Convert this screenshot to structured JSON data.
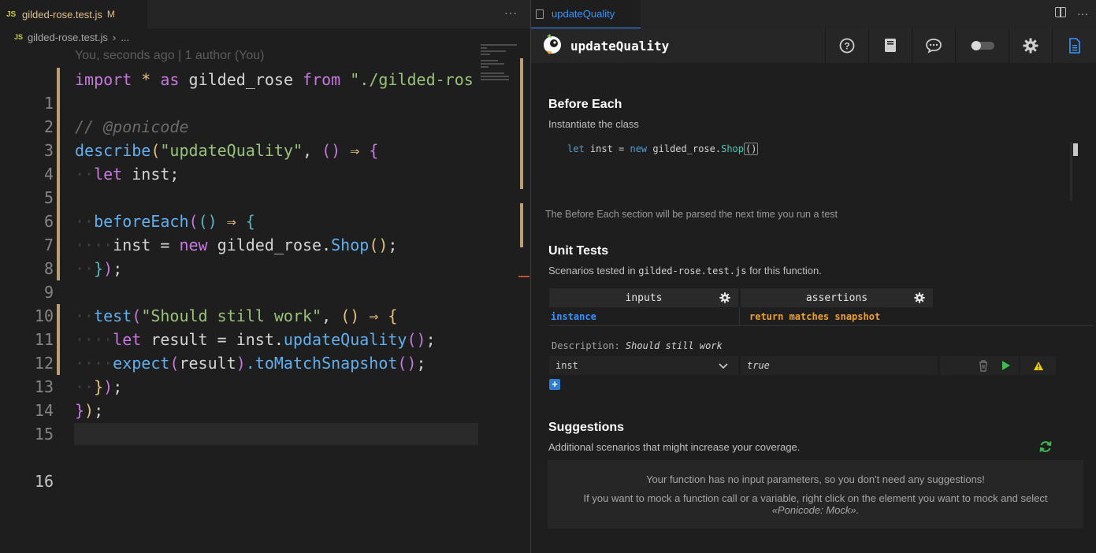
{
  "editor": {
    "tab": {
      "icon": "js-icon",
      "name": "gilded-rose.test.js",
      "status": "M",
      "more": "···"
    },
    "breadcrumb": {
      "file": "gilded-rose.test.js",
      "sep": "›",
      "more": "..."
    },
    "blame": "You, seconds ago | 1 author (You)",
    "lines": [
      {
        "n": "1"
      },
      {
        "n": "2"
      },
      {
        "n": "3"
      },
      {
        "n": "4"
      },
      {
        "n": "5"
      },
      {
        "n": "6"
      },
      {
        "n": "7"
      },
      {
        "n": "8"
      },
      {
        "n": "9"
      },
      {
        "n": "10"
      },
      {
        "n": "11"
      },
      {
        "n": "12"
      },
      {
        "n": "13"
      },
      {
        "n": "14"
      },
      {
        "n": "15"
      },
      {
        "n": "16"
      }
    ],
    "code": {
      "l1": [
        "import",
        "*",
        "as",
        "gilded_rose",
        "from",
        "\"./gilded-ros"
      ],
      "l3": "// @ponicode",
      "l4": [
        "describe",
        "(",
        "\"updateQuality\"",
        ", ",
        "()",
        " ⇒ ",
        "{"
      ],
      "l5": [
        "let",
        " inst;"
      ],
      "l7": [
        "beforeEach",
        "(",
        "()",
        " ⇒ ",
        "{"
      ],
      "l8": [
        "inst",
        " = ",
        "new",
        " gilded_rose.",
        "Shop",
        "()",
        ";"
      ],
      "l9": [
        "}",
        ")",
        ";"
      ],
      "l11": [
        "test",
        "(",
        "\"Should still work\"",
        ", ",
        "()",
        " ⇒ ",
        "{"
      ],
      "l12": [
        "let",
        " result = inst.",
        "updateQuality",
        "()",
        ";"
      ],
      "l13": [
        "expect",
        "(",
        "result",
        ")",
        ".toMatchSnapshot",
        "()",
        ";"
      ],
      "l14": [
        "}",
        ")",
        ";"
      ],
      "l15": [
        "}",
        ")",
        ";"
      ]
    }
  },
  "panel": {
    "tab": {
      "icon": "document-icon",
      "name": "updateQuality",
      "more": "···"
    },
    "title": "updateQuality",
    "toolbar_icons": [
      "help-icon",
      "book-icon",
      "chat-icon",
      "toggle-icon",
      "gear-icon",
      "document-icon"
    ],
    "before_each": {
      "title": "Before Each",
      "subtitle": "Instantiate the class",
      "code": [
        "let",
        " inst = ",
        "new",
        " gilded_rose.",
        "Shop",
        "()"
      ],
      "note": "The Before Each section will be parsed the next time you run a test"
    },
    "unit_tests": {
      "title": "Unit Tests",
      "subtitle_pre": "Scenarios tested in ",
      "subtitle_file": "gilded-rose.test.js",
      "subtitle_post": " for this function.",
      "col_inputs": "inputs",
      "col_assertions": "assertions",
      "head_input": "instance",
      "head_assertion": "return matches snapshot",
      "description_label": "Description:",
      "description": "Should still work",
      "row": {
        "input": "inst",
        "assertion": "true"
      }
    },
    "suggestions": {
      "title": "Suggestions",
      "subtitle": "Additional scenarios that might increase your coverage.",
      "line1": "Your function has no input parameters, so you don't need any suggestions!",
      "line2": "If you want to mock a function call or a variable, right click on the element you want to mock and select",
      "line3": "«Ponicode: Mock»."
    },
    "colors": {
      "accent_blue": "#3794ff",
      "warning": "#f5d000",
      "run_green": "#3fb950",
      "assert_orange": "#f0a030"
    }
  }
}
